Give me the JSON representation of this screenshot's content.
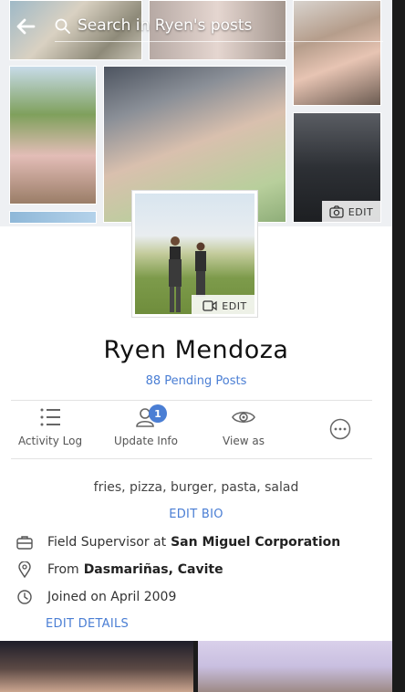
{
  "search": {
    "placeholder": "Search in Ryen's posts"
  },
  "cover": {
    "edit_label": "EDIT"
  },
  "profile_photo": {
    "edit_label": "EDIT"
  },
  "profile": {
    "name": "Ryen Mendoza",
    "pending_posts": "88 Pending Posts"
  },
  "actions": [
    {
      "label": "Activity Log",
      "icon": "list-icon"
    },
    {
      "label": "Update Info",
      "icon": "person-icon",
      "badge": "1"
    },
    {
      "label": "View as",
      "icon": "eye-icon"
    },
    {
      "label": "",
      "icon": "more-icon"
    }
  ],
  "bio": {
    "text": "fries, pizza, burger, pasta, salad",
    "edit_label": "EDIT BIO"
  },
  "details": {
    "work_prefix": "Field Supervisor at",
    "work_company": "San Miguel Corporation",
    "from_prefix": "From",
    "from_place": "Dasmariñas, Cavite",
    "joined": "Joined on April 2009",
    "edit_label": "EDIT DETAILS"
  },
  "colors": {
    "accent": "#4a7ed4",
    "badge": "#4a7ed4"
  }
}
